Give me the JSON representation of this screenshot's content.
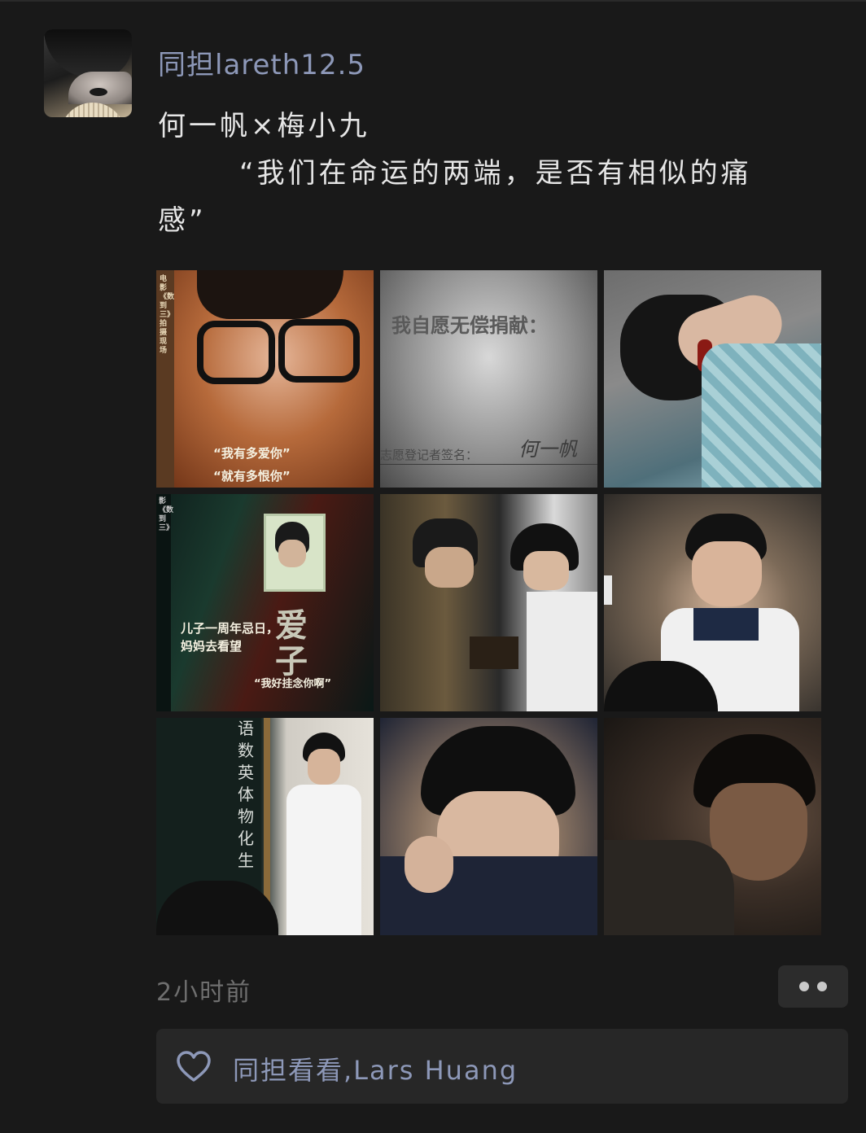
{
  "post": {
    "username": "同担lareth12.5",
    "text_line1": "何一帆×梅小九",
    "text_line2": "“我们在命运的两端，是否有相似的痛",
    "text_line3": "感”",
    "time": "2小时前"
  },
  "photos": {
    "p1_caption1": "“我有多爱你”",
    "p1_caption2": "“就有多恨你”",
    "p1_side": "电影《数到三》拍摄现场",
    "p2_heading": "我自愿无偿捐献：",
    "p2_sign_label": "志愿登记者签名：",
    "p2_signature": "何一帆",
    "p4_side": "影《数到三》",
    "p4_caption1": "儿子一周年忌日，",
    "p4_caption2": "妈妈去看望",
    "p4_big": "爱子",
    "p4_quote": "“我好挂念你啊”",
    "p7_board": "语数英体物化生"
  },
  "likes": {
    "text": "同担看看,Lars Huang"
  },
  "colors": {
    "background": "#191919",
    "link_blue": "#8d98b8",
    "secondary_text": "#6f6f6f"
  },
  "icons": {
    "avatar": "avatar-image",
    "like": "heart-outline-icon",
    "more": "more-dots-icon"
  }
}
